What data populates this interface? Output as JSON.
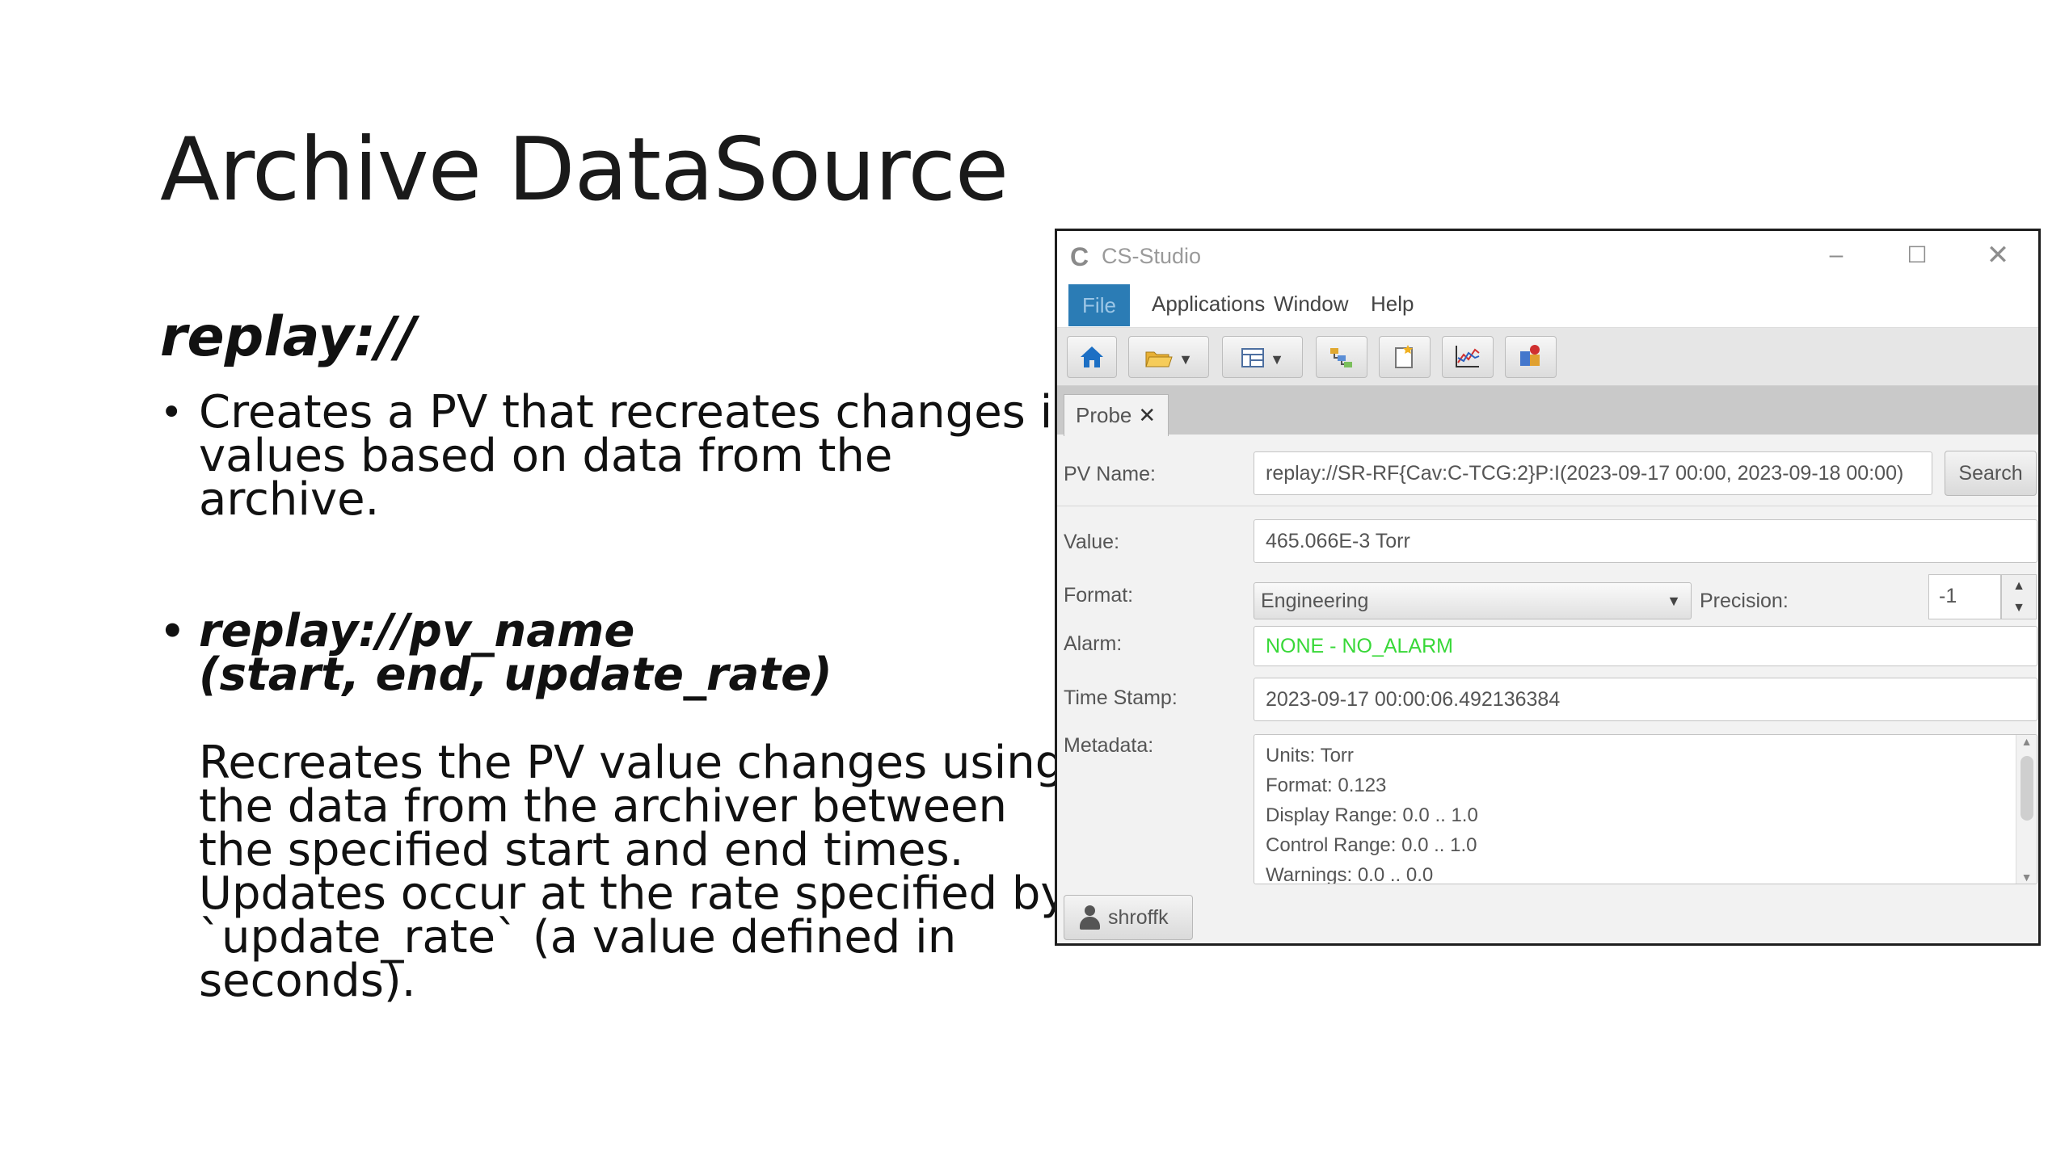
{
  "slide": {
    "title": "Archive DataSource",
    "heading": "replay://",
    "bullet1": "Creates a PV that recreates changes in\nvalues based on data from the\narchive.",
    "bullet2": "replay://pv_name\n(start, end, update_rate)",
    "paragraph": "Recreates the PV value changes using\nthe data from the archiver between\nthe specified start and end times.\nUpdates occur at the rate specified by\n`update_rate` (a value defined in\nseconds).",
    "bullet_glyph": "•"
  },
  "window": {
    "title": "CS-Studio",
    "logo_glyph": "C",
    "controls": {
      "minimize": "–",
      "maximize": "☐",
      "close": "✕"
    },
    "menu": [
      "File",
      "Applications",
      "Window",
      "Help"
    ],
    "toolbar_icons": [
      "home-icon",
      "open-folder-icon",
      "layout-icon",
      "probe-icon",
      "new-display-icon",
      "data-browser-icon",
      "alarm-tree-icon"
    ],
    "tab": {
      "label": "Probe",
      "close": "✕"
    },
    "pv_name": {
      "label": "PV Name:",
      "value": "replay://SR-RF{Cav:C-TCG:2}P:I(2023-09-17 00:00, 2023-09-18 00:00)",
      "search_label": "Search"
    },
    "value": {
      "label": "Value:",
      "value": "465.066E-3 Torr"
    },
    "format": {
      "label": "Format:",
      "selected": "Engineering",
      "precision_label": "Precision:",
      "precision_value": "-1"
    },
    "alarm": {
      "label": "Alarm:",
      "value": "NONE - NO_ALARM",
      "color": "#38d838"
    },
    "timestamp": {
      "label": "Time Stamp:",
      "value": "2023-09-17 00:00:06.492136384"
    },
    "metadata": {
      "label": "Metadata:",
      "lines": [
        "Units: Torr",
        "Format: 0.123",
        "Display Range: 0.0 .. 1.0",
        "Control Range: 0.0 .. 1.0",
        "Warnings: 0.0 .. 0.0"
      ]
    },
    "user": {
      "name": "shroffk"
    },
    "accent_color": "#2b7cb5"
  }
}
